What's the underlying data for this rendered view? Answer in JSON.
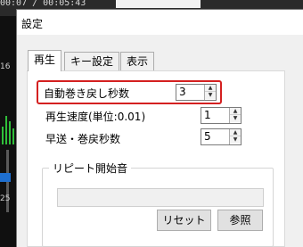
{
  "background": {
    "time_text": "00:07 / 00:05:43",
    "left_labels": [
      "16",
      "25"
    ]
  },
  "dialog": {
    "title": "設定"
  },
  "tabs": [
    {
      "label": "再生",
      "active": true
    },
    {
      "label": "キー設定",
      "active": false
    },
    {
      "label": "表示",
      "active": false
    }
  ],
  "settings": {
    "rewind_seconds": {
      "label": "自動巻き戻し秒数",
      "value": "3"
    },
    "speed_unit": {
      "label": "再生速度(単位:0.01)",
      "value": "1"
    },
    "ff_rewind_seconds": {
      "label": "早送・巻戻秒数",
      "value": "5"
    }
  },
  "repeat_start_sound": {
    "group_label": "リピート開始音",
    "path_value": "",
    "reset_label": "リセット",
    "browse_label": "参照"
  },
  "colors": {
    "highlight": "#d42020",
    "accent": "#1e6fd0"
  }
}
